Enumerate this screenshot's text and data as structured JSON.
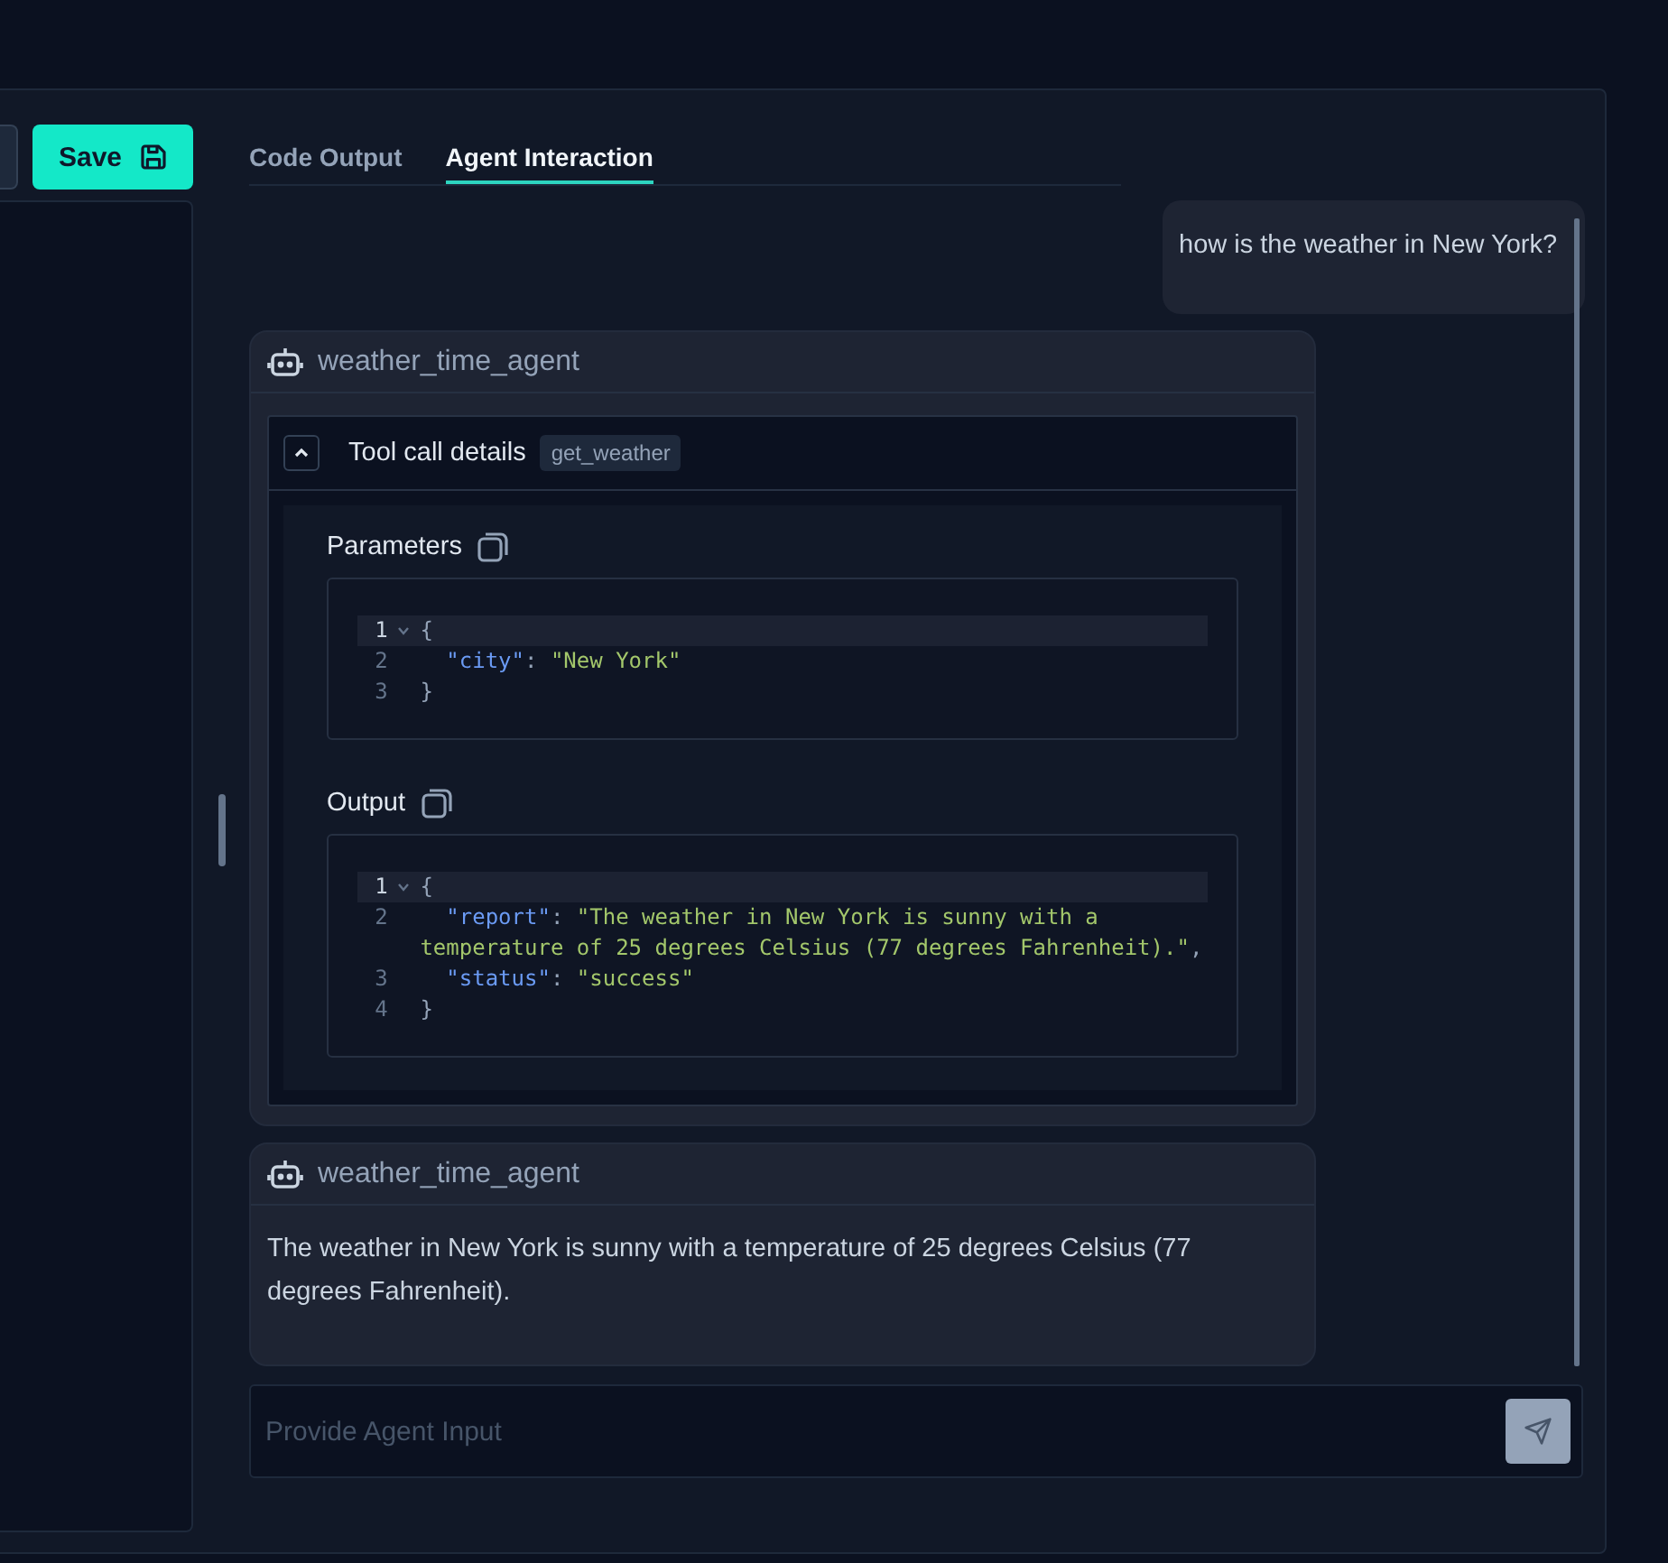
{
  "toolbar": {
    "save_label": "Save"
  },
  "tabs": [
    {
      "label": "Code Output",
      "selected": false
    },
    {
      "label": "Agent Interaction",
      "selected": true
    }
  ],
  "messages": [
    {
      "kind": "user",
      "text": "how is the weather in New York?"
    },
    {
      "kind": "tool",
      "agent": "weather_time_agent",
      "tool_title": "Tool call details",
      "tool_name": "get_weather",
      "expanded": true,
      "sections": [
        {
          "title": "Parameters",
          "lines": [
            {
              "number": "1",
              "fold": true,
              "tokens": [
                {
                  "kind": "punct",
                  "text": "{"
                }
              ]
            },
            {
              "number": "2",
              "fold": false,
              "tokens": [
                {
                  "kind": "key",
                  "text": "\"city\""
                },
                {
                  "kind": "punct",
                  "text": ": "
                },
                {
                  "kind": "string",
                  "text": "\"New York\""
                }
              ]
            },
            {
              "number": "3",
              "fold": false,
              "tokens": [
                {
                  "kind": "punct",
                  "text": "}"
                }
              ]
            }
          ]
        },
        {
          "title": "Output",
          "lines": [
            {
              "number": "1",
              "fold": true,
              "tokens": [
                {
                  "kind": "punct",
                  "text": "{"
                }
              ]
            },
            {
              "number": "2",
              "fold": false,
              "tokens": [
                {
                  "kind": "key",
                  "text": "\"report\""
                },
                {
                  "kind": "punct",
                  "text": ": "
                },
                {
                  "kind": "string",
                  "text": "\"The weather in New York is sunny with a temperature of 25 degrees Celsius (77 degrees Fahrenheit).\""
                },
                {
                  "kind": "punct",
                  "text": ","
                }
              ]
            },
            {
              "number": "3",
              "fold": false,
              "tokens": [
                {
                  "kind": "key",
                  "text": "\"status\""
                },
                {
                  "kind": "punct",
                  "text": ": "
                },
                {
                  "kind": "string",
                  "text": "\"success\""
                }
              ]
            },
            {
              "number": "4",
              "fold": false,
              "tokens": [
                {
                  "kind": "punct",
                  "text": "}"
                }
              ]
            }
          ]
        }
      ]
    },
    {
      "kind": "agent",
      "agent": "weather_time_agent",
      "text": "The weather in New York is sunny with a temperature of 25 degrees Celsius (77 degrees Fahrenheit)."
    }
  ],
  "input": {
    "placeholder": "Provide Agent Input"
  }
}
